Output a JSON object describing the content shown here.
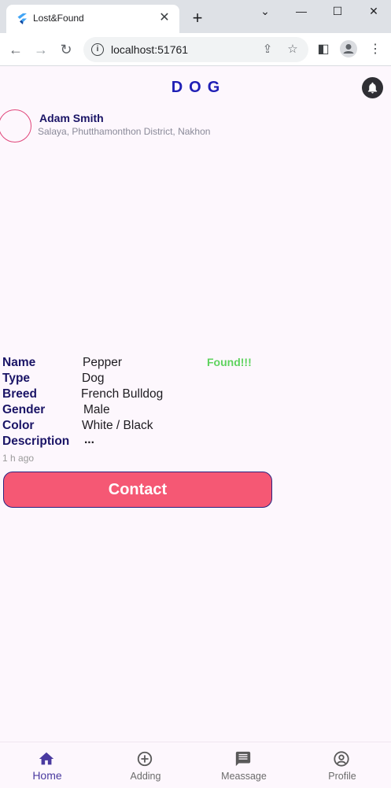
{
  "browser": {
    "tab_title": "Lost&Found",
    "tab_close": "✕",
    "new_tab": "+",
    "url": "localhost:51761",
    "window_controls": [
      "⌄",
      "—",
      "☐",
      "✕"
    ]
  },
  "app": {
    "title": "DOG",
    "notification_icon": "bell-icon"
  },
  "post": {
    "user_name": "Adam Smith",
    "location": "Salaya, Phutthamonthon District, Nakhon",
    "status": "Found!!!",
    "timestamp": "1 h ago",
    "details": [
      {
        "label": "Name",
        "value": "Pepper"
      },
      {
        "label": "Type",
        "value": "Dog"
      },
      {
        "label": "Breed",
        "value": "French Bulldog"
      },
      {
        "label": "Gender",
        "value": "Male"
      },
      {
        "label": "Color",
        "value": "White / Black"
      },
      {
        "label": "Description",
        "value": "..."
      }
    ],
    "contact_label": "Contact"
  },
  "bottom_nav": {
    "items": [
      {
        "label": "Home",
        "icon": "home-icon",
        "active": true
      },
      {
        "label": "Adding",
        "icon": "add-circle-icon",
        "active": false
      },
      {
        "label": "Meassage",
        "icon": "message-icon",
        "active": false
      },
      {
        "label": "Profile",
        "icon": "profile-icon",
        "active": false
      }
    ]
  },
  "colors": {
    "title": "#1f1fb5",
    "label": "#1a1466",
    "status_found": "#5fd35f",
    "contact_button": "#f55874",
    "nav_active": "#4a3aa0"
  }
}
